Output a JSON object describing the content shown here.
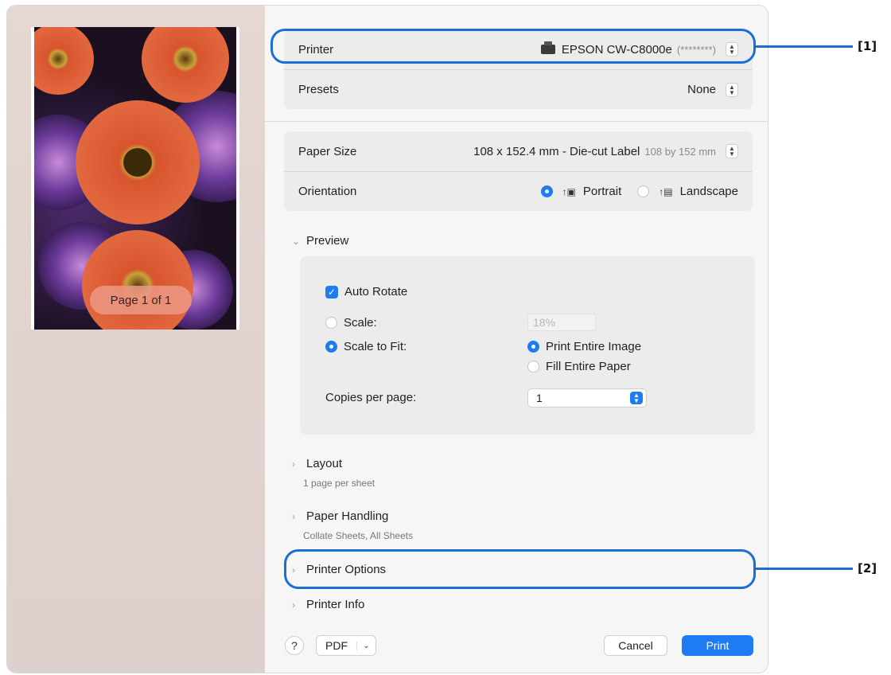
{
  "preview": {
    "page_indicator": "Page 1 of 1"
  },
  "printer_group": {
    "printer_label": "Printer",
    "printer_value": "EPSON CW-C8000e",
    "printer_suffix": "(********)",
    "presets_label": "Presets",
    "presets_value": "None"
  },
  "paper_group": {
    "paper_size_label": "Paper Size",
    "paper_size_value": "108 x 152.4 mm - Die-cut Label",
    "paper_size_dims": "108 by 152 mm",
    "orientation_label": "Orientation",
    "portrait_label": "Portrait",
    "landscape_label": "Landscape",
    "orientation_selected": "Portrait"
  },
  "preview_section": {
    "title": "Preview",
    "auto_rotate_label": "Auto Rotate",
    "auto_rotate_checked": true,
    "scale_label": "Scale:",
    "scale_value": "18%",
    "scale_to_fit_label": "Scale to Fit:",
    "print_entire_image_label": "Print Entire Image",
    "fill_entire_paper_label": "Fill Entire Paper",
    "copies_per_page_label": "Copies per page:",
    "copies_per_page_value": "1"
  },
  "sections": [
    {
      "title": "Layout",
      "subtitle": "1 page per sheet"
    },
    {
      "title": "Paper Handling",
      "subtitle": "Collate Sheets, All Sheets"
    },
    {
      "title": "Printer Options"
    },
    {
      "title": "Printer Info"
    }
  ],
  "footer": {
    "help_label": "?",
    "pdf_label": "PDF",
    "cancel_label": "Cancel",
    "print_label": "Print"
  },
  "callouts": {
    "one": "[1]",
    "two": "[2]"
  },
  "colors": {
    "accent": "#1f7bf1",
    "callout": "#1a6fd6"
  }
}
